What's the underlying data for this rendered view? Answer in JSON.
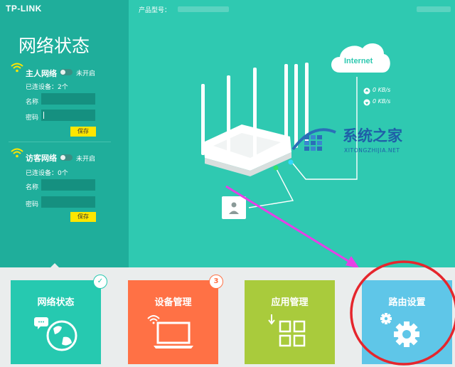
{
  "brand": {
    "logo": "TP-LINK"
  },
  "header": {
    "model_label": "产品型号："
  },
  "sidebar": {
    "title": "网络状态",
    "main_network": {
      "title": "主人网络",
      "toggle_state": "未开启",
      "devices": "已连设备：2个",
      "name_label": "名称",
      "password_label": "密码",
      "save_label": "保存"
    },
    "guest_network": {
      "title": "访客网络",
      "toggle_state": "未开启",
      "devices": "已连设备：0个",
      "name_label": "名称",
      "password_label": "密码",
      "save_label": "保存"
    }
  },
  "diagram": {
    "cloud_label": "Internet",
    "upload_speed": "0 KB/s",
    "download_speed": "0 KB/s"
  },
  "watermark": {
    "title": "系统之家",
    "url": "XITONGZHIJIA.NET"
  },
  "tiles": [
    {
      "label": "网络状态",
      "icon": "globe-icon",
      "color": "#26c9b0"
    },
    {
      "label": "设备管理",
      "icon": "laptop-wifi-icon",
      "color": "#ff7145",
      "badge": "3"
    },
    {
      "label": "应用管理",
      "icon": "apps-grid-icon",
      "color": "#a9cb3c"
    },
    {
      "label": "路由设置",
      "icon": "gear-icon",
      "color": "#5fc6e8"
    }
  ],
  "colors": {
    "header_bg": "#2fc9b1",
    "sidebar_bg": "#1fae9b",
    "save_button": "#ffe600",
    "annotation": "#e640e6",
    "highlight_circle": "#e5262d"
  }
}
